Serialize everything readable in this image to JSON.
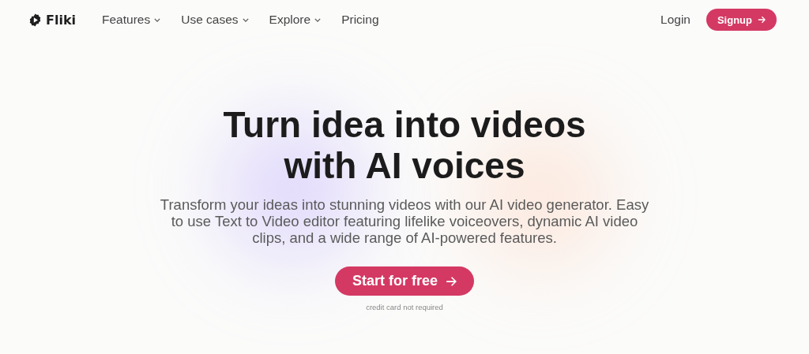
{
  "nav": {
    "logo": "Fliki",
    "items": [
      {
        "label": "Features",
        "kind": "dropdown"
      },
      {
        "label": "Use cases",
        "kind": "dropdown"
      },
      {
        "label": "Explore",
        "kind": "dropdown"
      },
      {
        "label": "Pricing",
        "kind": "link"
      }
    ],
    "login": "Login",
    "signup": "Signup"
  },
  "hero": {
    "title_lines": [
      "Turn idea into videos",
      "with AI voices"
    ],
    "subtitle": "Transform your ideas into stunning videos with our AI video generator. Easy to use Text to Video editor featuring lifelike voiceovers, dynamic AI video clips, and a wide range of AI-powered features.",
    "cta": "Start for free",
    "note": "credit card not required"
  }
}
